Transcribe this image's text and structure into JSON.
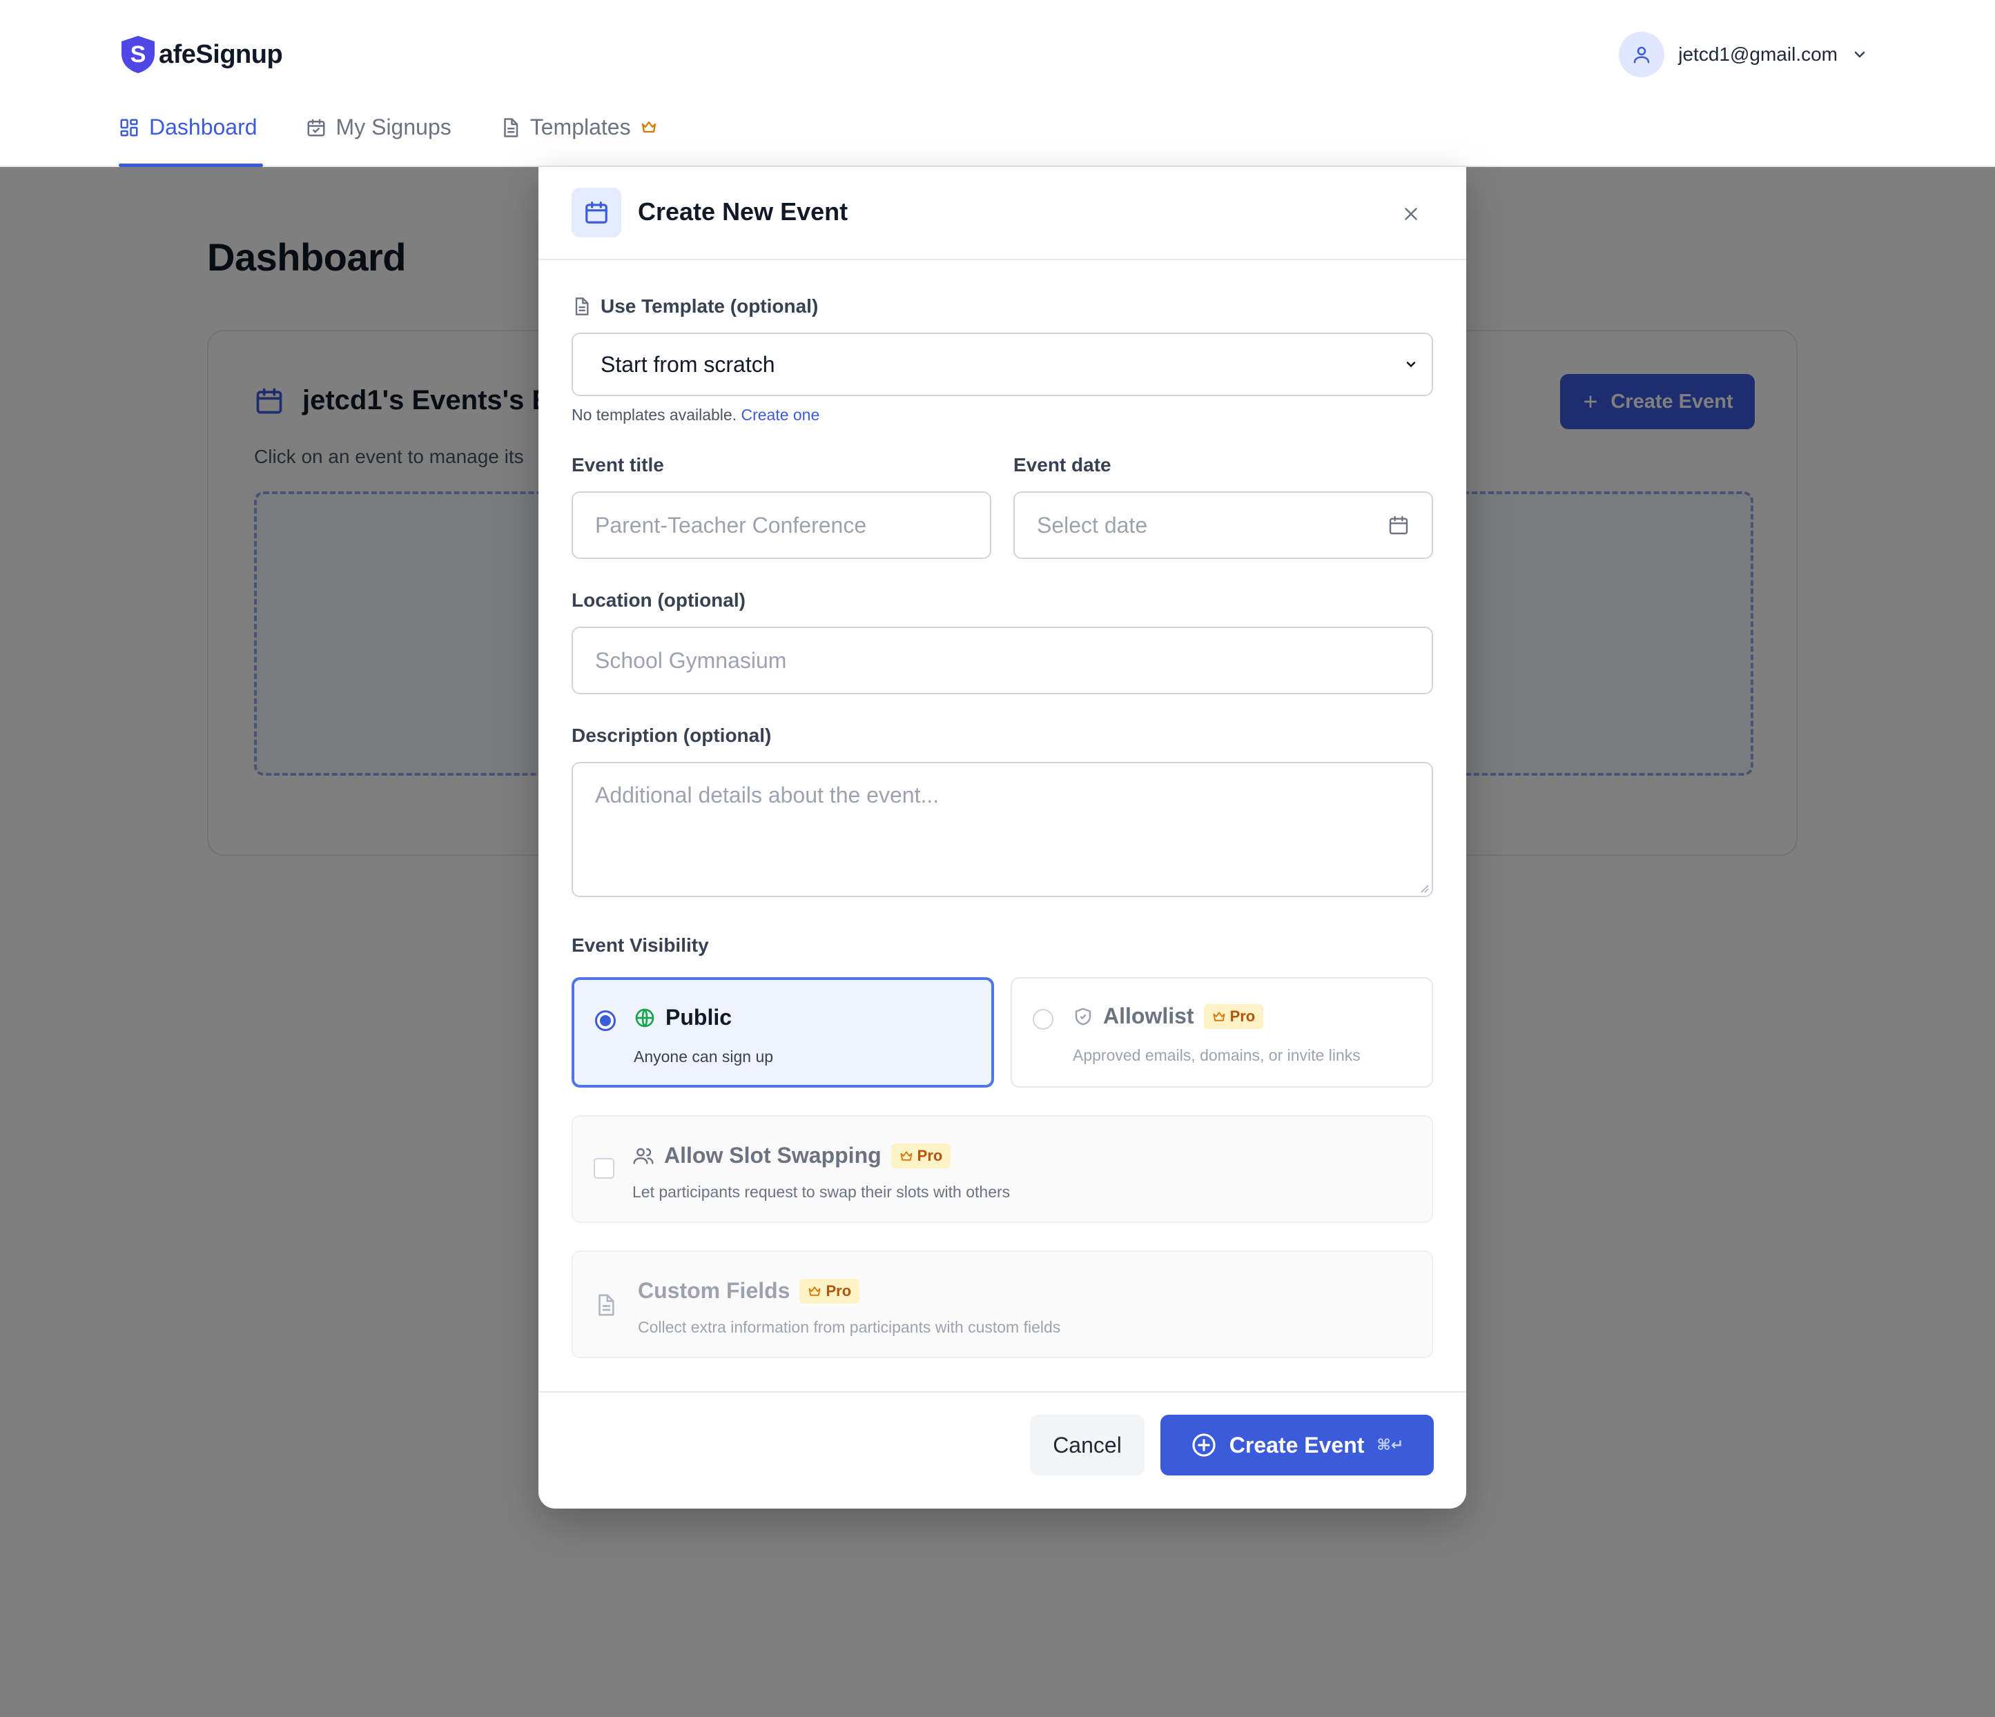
{
  "app": {
    "brand_letter": "S",
    "brand_rest": "afeSignup",
    "account_email": "jetcd1@gmail.com"
  },
  "nav": {
    "tabs": [
      {
        "label": "Dashboard",
        "active": true
      },
      {
        "label": "My Signups",
        "active": false
      },
      {
        "label": "Templates",
        "active": false
      }
    ]
  },
  "page": {
    "title": "Dashboard",
    "events_card": {
      "title": "jetcd1's Events's E",
      "subtitle": "Click on an event to manage its",
      "create_label": "Create Event"
    }
  },
  "modal": {
    "title": "Create New Event",
    "template": {
      "label": "Use Template (optional)",
      "selected": "Start from scratch",
      "hint": "No templates available.",
      "hint_link": "Create one"
    },
    "event_title": {
      "label": "Event title",
      "placeholder": "Parent-Teacher Conference"
    },
    "event_date": {
      "label": "Event date",
      "placeholder": "Select date"
    },
    "location": {
      "label": "Location (optional)",
      "placeholder": "School Gymnasium"
    },
    "description": {
      "label": "Description (optional)",
      "placeholder": "Additional details about the event..."
    },
    "visibility": {
      "label": "Event Visibility",
      "options": [
        {
          "title": "Public",
          "desc": "Anyone can sign up",
          "selected": true
        },
        {
          "title": "Allowlist",
          "desc": "Approved emails, domains, or invite links",
          "selected": false,
          "badge": "Pro"
        }
      ]
    },
    "slot_swapping": {
      "title": "Allow Slot Swapping",
      "badge": "Pro",
      "desc": "Let participants request to swap their slots with others",
      "checked": false
    },
    "custom_fields": {
      "title": "Custom Fields",
      "badge": "Pro",
      "desc": "Collect extra information from participants with custom fields"
    },
    "footer": {
      "cancel_label": "Cancel",
      "create_label": "Create Event",
      "shortcut": "⌘↵"
    }
  },
  "colors": {
    "accent": "#3b5bdb",
    "pro_badge_bg": "#fef3c7",
    "pro_badge_text": "#b45309",
    "public_icon": "#16a34a"
  }
}
